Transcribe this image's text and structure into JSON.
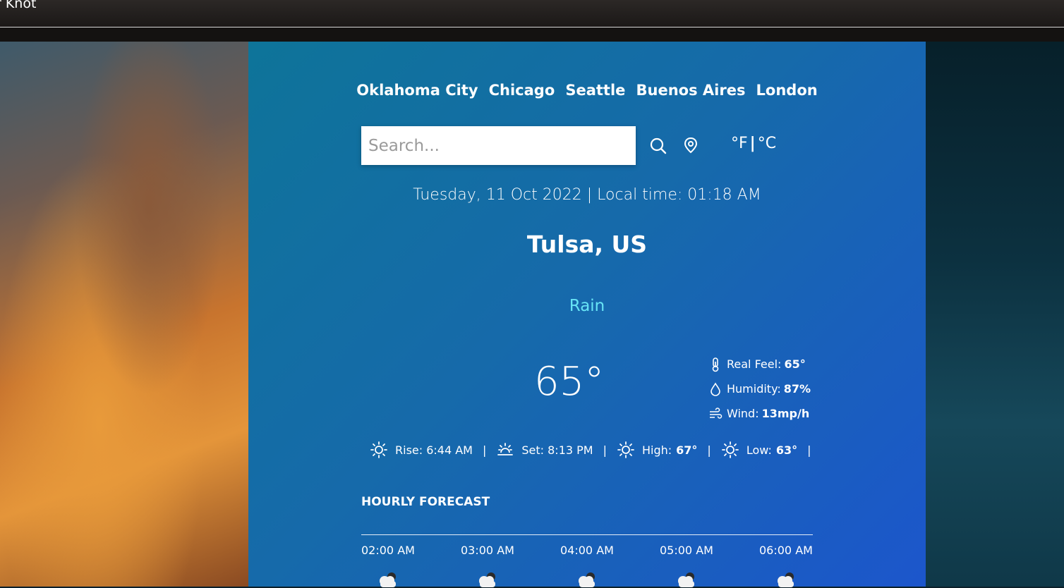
{
  "header": {
    "brand": "r Knot"
  },
  "cities": [
    "Oklahoma City",
    "Chicago",
    "Seattle",
    "Buenos Aires",
    "London"
  ],
  "search": {
    "placeholder": "Search..."
  },
  "units": {
    "fahrenheit": "°F",
    "separator": "|",
    "celsius": "°C"
  },
  "datetime": "Tuesday, 11 Oct 2022 | Local time: 01:18 AM",
  "location": "Tulsa, US",
  "condition": "Rain",
  "temperature": "65°",
  "details": {
    "real_feel_label": "Real Feel:",
    "real_feel_value": "65°",
    "humidity_label": "Humidity:",
    "humidity_value": "87%",
    "wind_label": "Wind:",
    "wind_value": "13mp/h"
  },
  "sun": {
    "rise": "Rise: 6:44 AM",
    "set": "Set: 8:13 PM",
    "high_label": "High:",
    "high_value": "67°",
    "low_label": "Low:",
    "low_value": "63°",
    "separator": "|"
  },
  "hourly": {
    "title": "HOURLY FORECAST",
    "times": [
      "02:00 AM",
      "03:00 AM",
      "04:00 AM",
      "05:00 AM",
      "06:00 AM"
    ]
  },
  "colors": {
    "condition": "#67e4f5",
    "panel_start": "#0e7499",
    "panel_end": "#1c56cc"
  }
}
